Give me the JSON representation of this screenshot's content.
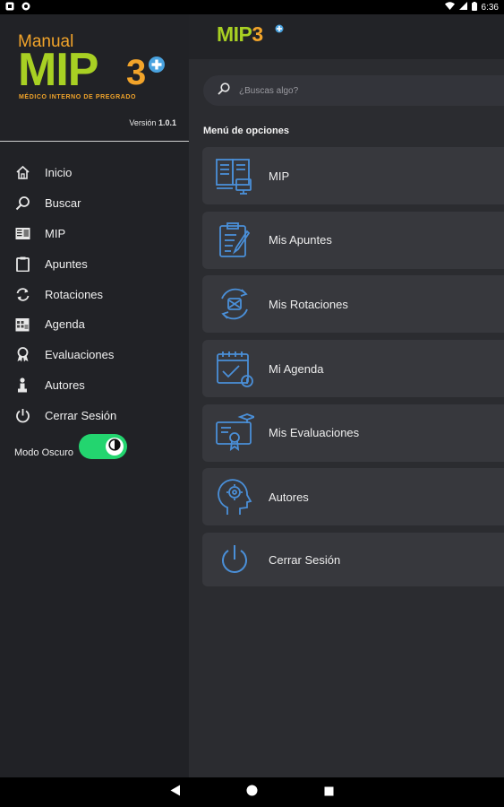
{
  "status_bar": {
    "time": "6:36"
  },
  "drawer": {
    "logo": {
      "manual": "Manual",
      "mip": "MIP",
      "three": "3",
      "subtitle": "MÉDICO INTERNO DE PREGRADO"
    },
    "version_label": "Versión",
    "version_number": "1.0.1",
    "items": [
      {
        "label": "Inicio",
        "icon": "home-icon"
      },
      {
        "label": "Buscar",
        "icon": "search-icon"
      },
      {
        "label": "MIP",
        "icon": "book-icon"
      },
      {
        "label": "Apuntes",
        "icon": "clipboard-icon"
      },
      {
        "label": "Rotaciones",
        "icon": "rotate-icon"
      },
      {
        "label": "Agenda",
        "icon": "calendar-icon"
      },
      {
        "label": "Evaluaciones",
        "icon": "award-icon"
      },
      {
        "label": "Autores",
        "icon": "person-icon"
      },
      {
        "label": "Cerrar Sesión",
        "icon": "power-icon"
      }
    ],
    "dark_mode_label": "Modo Oscuro",
    "dark_mode_on": true
  },
  "main": {
    "app_bar_logo": "MIP",
    "app_bar_three": "3",
    "search_placeholder": "¿Buscas algo?",
    "section_title": "Menú de opciones",
    "cards": [
      {
        "label": "MIP",
        "icon": "books-icon"
      },
      {
        "label": "Mis Apuntes",
        "icon": "notes-icon"
      },
      {
        "label": "Mis Rotaciones",
        "icon": "rotation-icon"
      },
      {
        "label": "Mi Agenda",
        "icon": "agenda-icon"
      },
      {
        "label": "Mis Evaluaciones",
        "icon": "certificate-icon"
      },
      {
        "label": "Autores",
        "icon": "head-icon"
      },
      {
        "label": "Cerrar Sesión",
        "icon": "power-icon"
      }
    ]
  },
  "colors": {
    "accent_green": "#a8d023",
    "accent_orange": "#f2a42a",
    "icon_blue": "#4a8fd8",
    "toggle_green": "#23d56f",
    "drawer_bg": "#212226",
    "main_bg": "#2b2c30",
    "card_bg": "#37383d"
  }
}
